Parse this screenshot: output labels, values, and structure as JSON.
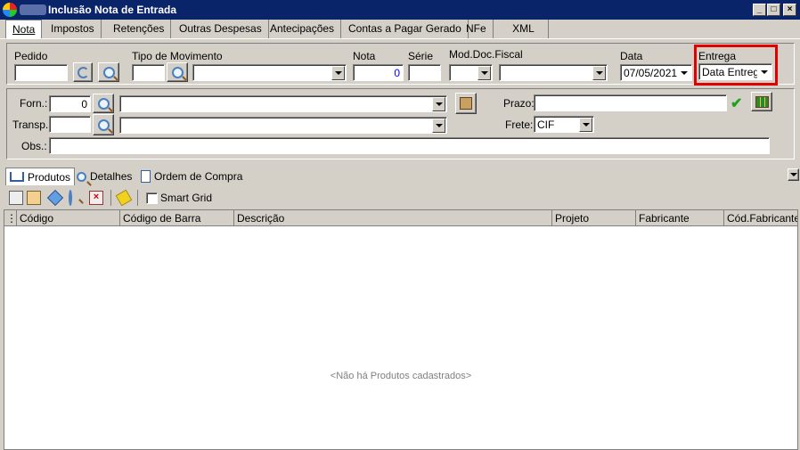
{
  "window": {
    "title": "Inclusão Nota de Entrada",
    "controls": {
      "minimize": "_",
      "maximize": "□",
      "close": "×"
    }
  },
  "tabs": [
    "Nota",
    "Impostos",
    "Retenções",
    "Outras Despesas",
    "Antecipações",
    "Contas a Pagar Gerado",
    "NFe",
    "XML"
  ],
  "header": {
    "pedido_label": "Pedido",
    "tipo_mov_label": "Tipo de Movimento",
    "nota_label": "Nota",
    "nota_value": "0",
    "serie_label": "Série",
    "mod_doc_label": "Mod.Doc.Fiscal",
    "data_label": "Data",
    "data_value": "07/05/2021",
    "entrega_label": "Entrega",
    "entrega_value": "Data Entrega"
  },
  "supplier": {
    "forn_label": "Forn.:",
    "forn_value": "0",
    "transp_label": "Transp.:",
    "obs_label": "Obs.:",
    "prazo_label": "Prazo:",
    "frete_label": "Frete:",
    "frete_value": "CIF"
  },
  "subtabs": [
    "Produtos",
    "Detalhes",
    "Ordem de Compra"
  ],
  "toolbar": {
    "smart_grid_label": "Smart Grid"
  },
  "grid": {
    "columns": [
      "Código",
      "Código de Barra",
      "Descrição",
      "Projeto",
      "Fabricante",
      "Cód.Fabricante"
    ],
    "empty_message": "<Não há Produtos cadastrados>"
  },
  "colors": {
    "titlebar": "#0a246a",
    "highlight": "#e00000",
    "face": "#d4d0c8"
  }
}
